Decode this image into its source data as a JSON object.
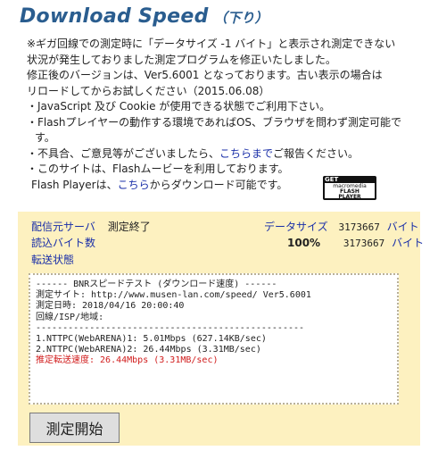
{
  "header": {
    "title": "Download Speed",
    "subtitle": "（下り）"
  },
  "notes": {
    "line1": "※ギガ回線での測定時に「データサイズ -1 バイト」と表示され測定できない",
    "line2": "状況が発生しておりました測定プログラムを修正いたしました。",
    "line3": "修正後のバージョンは、Ver5.6001 となっております。古い表示の場合は",
    "line4": "リロードしてからお試しください（2015.06.08）",
    "line5": "・JavaScript 及び Cookie が使用できる状態でご利用下さい。",
    "line6": "・Flashプレイヤーの動作する環境であればOS、ブラウザを問わず測定可能で",
    "line7": "す。",
    "line8_pre": "・不具合、ご意見等がございましたら、",
    "line8_link": "こちらまで",
    "line8_post": "ご報告ください。",
    "line9": "・このサイトは、Flashムービーを利用しております。",
    "line10_pre": "Flash Playerは、",
    "line10_link": "こちら",
    "line10_post": "からダウンロード可能です。"
  },
  "flash_badge": {
    "get": "GET",
    "line1": "macromedia",
    "line2": "FLASH",
    "line3": "PLAYER"
  },
  "status": {
    "server_label": "配信元サーバ",
    "server_value": "測定終了",
    "datasize_label": "データサイズ",
    "datasize_value": "3173667",
    "datasize_unit": "バイト",
    "read_label": "読込バイト数",
    "read_percent": "100%",
    "read_value": "3173667",
    "read_unit": "バイト",
    "transfer_label": "転送状態"
  },
  "result": {
    "line1": "------ BNRスピードテスト (ダウンロード速度) ------",
    "line2": "測定サイト: http://www.musen-lan.com/speed/ Ver5.6001",
    "line3": "測定日時: 2018/04/16 20:00:40",
    "line4": "回線/ISP/地域:",
    "line5": "--------------------------------------------------",
    "line6": "1.NTTPC(WebARENA)1: 5.01Mbps (627.14KB/sec)",
    "line7": "2.NTTPC(WebARENA)2: 26.44Mbps (3.31MB/sec)",
    "line8": "推定転送速度: 26.44Mbps (3.31MB/sec)"
  },
  "start_button": {
    "label": "測定開始"
  }
}
